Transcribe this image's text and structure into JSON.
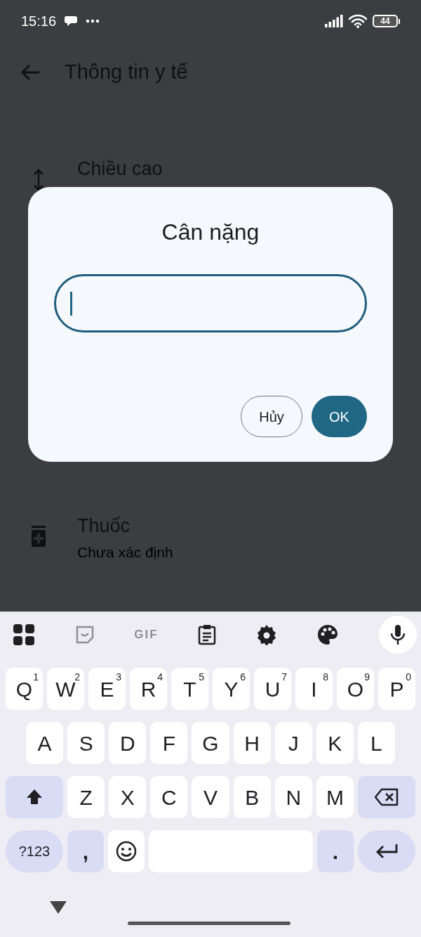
{
  "status_bar": {
    "time": "15:16",
    "battery": "44"
  },
  "app_bar": {
    "title": "Thông tin y tế"
  },
  "list": [
    {
      "kind": "height",
      "title": "Chiều cao"
    },
    {
      "kind": "medication",
      "title": "Thuốc",
      "subtitle": "Chưa xác định"
    }
  ],
  "dialog": {
    "title": "Cân nặng",
    "field": {
      "focused": true
    },
    "buttons": [
      {
        "label": "Hủy",
        "kind": "outlined"
      },
      {
        "label": "OK",
        "kind": "filled"
      }
    ]
  },
  "keyboard": {
    "toolbar": [
      {
        "kind": "apps"
      },
      {
        "kind": "sticker"
      },
      {
        "kind": "gif",
        "text": "GIF"
      },
      {
        "kind": "clipboard"
      },
      {
        "kind": "settings"
      },
      {
        "kind": "theme"
      },
      {
        "kind": "mic"
      }
    ],
    "rows": [
      {
        "keys": [
          {
            "label": "Q",
            "hint": "1"
          },
          {
            "label": "W",
            "hint": "2"
          },
          {
            "label": "E",
            "hint": "3"
          },
          {
            "label": "R",
            "hint": "4"
          },
          {
            "label": "T",
            "hint": "5"
          },
          {
            "label": "Y",
            "hint": "6"
          },
          {
            "label": "U",
            "hint": "7"
          },
          {
            "label": "I",
            "hint": "8"
          },
          {
            "label": "O",
            "hint": "9"
          },
          {
            "label": "P",
            "hint": "0"
          }
        ]
      },
      {
        "keys": [
          {
            "label": "A"
          },
          {
            "label": "S"
          },
          {
            "label": "D"
          },
          {
            "label": "F"
          },
          {
            "label": "G"
          },
          {
            "label": "H"
          },
          {
            "label": "J"
          },
          {
            "label": "K"
          },
          {
            "label": "L"
          }
        ]
      },
      {
        "keys": [
          {
            "kind": "shift"
          },
          {
            "label": "Z"
          },
          {
            "label": "X"
          },
          {
            "label": "C"
          },
          {
            "label": "V"
          },
          {
            "label": "B"
          },
          {
            "label": "N"
          },
          {
            "label": "M"
          },
          {
            "kind": "backspace"
          }
        ]
      },
      {
        "keys": [
          {
            "kind": "symbols",
            "label": "?123"
          },
          {
            "kind": "punct",
            "label": ","
          },
          {
            "kind": "emoji"
          },
          {
            "kind": "space"
          },
          {
            "kind": "punct",
            "label": "."
          },
          {
            "kind": "enter"
          }
        ]
      }
    ]
  }
}
